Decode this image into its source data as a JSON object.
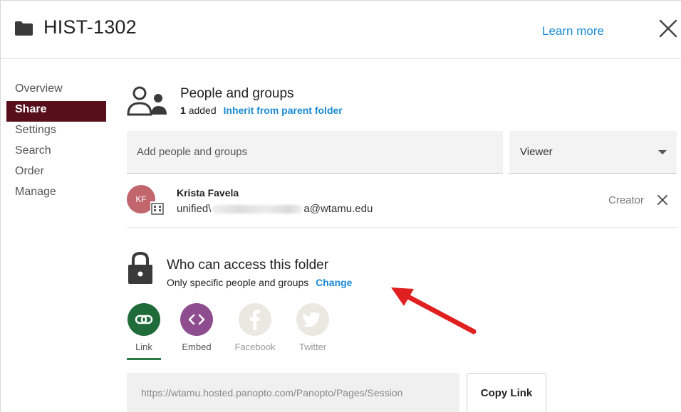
{
  "header": {
    "title": "HIST-1302",
    "learn_more": "Learn more"
  },
  "sidebar": {
    "items": [
      {
        "label": "Overview",
        "active": false
      },
      {
        "label": "Share",
        "active": true
      },
      {
        "label": "Settings",
        "active": false
      },
      {
        "label": "Search",
        "active": false
      },
      {
        "label": "Order",
        "active": false
      },
      {
        "label": "Manage",
        "active": false
      }
    ]
  },
  "people": {
    "title": "People and groups",
    "added_count": "1",
    "added_label": "added",
    "inherit_link": "Inherit from parent folder",
    "add_placeholder": "Add people and groups",
    "role_selected": "Viewer",
    "members": [
      {
        "initials": "KF",
        "name": "Krista Favela",
        "email_prefix": "unified\\",
        "email_suffix": "a@wtamu.edu",
        "role": "Creator"
      }
    ]
  },
  "access": {
    "title": "Who can access this folder",
    "description": "Only specific people and groups",
    "change_link": "Change"
  },
  "share_tabs": [
    {
      "label": "Link",
      "icon": "link-icon",
      "color": "#1f6b3a",
      "active": true
    },
    {
      "label": "Embed",
      "icon": "embed-icon",
      "color": "#8e4d8f",
      "active": false
    },
    {
      "label": "Facebook",
      "icon": "facebook-icon",
      "color": "#ebe8e2",
      "active": false
    },
    {
      "label": "Twitter",
      "icon": "twitter-icon",
      "color": "#ebe8e2",
      "active": false
    }
  ],
  "link": {
    "url": "https://wtamu.hosted.panopto.com/Panopto/Pages/Session",
    "copy_label": "Copy Link"
  },
  "colors": {
    "accent_blue": "#1a8bd4",
    "sidebar_active": "#57101b",
    "annotation_arrow": "#e02020"
  }
}
